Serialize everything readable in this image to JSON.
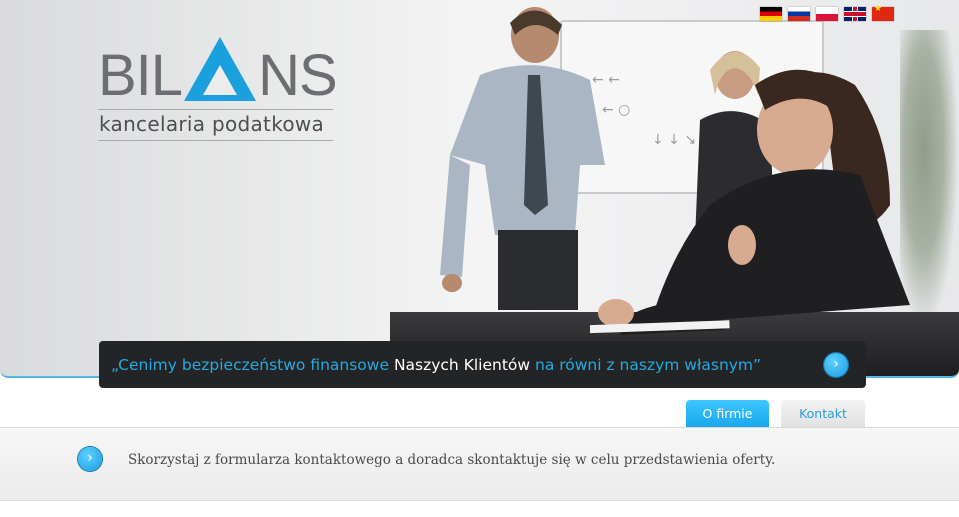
{
  "header": {
    "languages": [
      {
        "code": "de",
        "icon": "germany-flag-icon"
      },
      {
        "code": "ru",
        "icon": "russia-flag-icon"
      },
      {
        "code": "pl",
        "icon": "poland-flag-icon"
      },
      {
        "code": "en",
        "icon": "uk-flag-icon"
      },
      {
        "code": "zh",
        "icon": "china-flag-icon"
      }
    ],
    "logo": {
      "part1": "BIL",
      "part2": "NS",
      "subtitle": "kancelaria podatkowa"
    }
  },
  "quote": {
    "part1": "„Cenimy bezpieczeństwo finansowe ",
    "highlight": "Naszych Klientów",
    "part2": " na równi z naszym własnym”",
    "button_icon": "chevron-right-icon"
  },
  "tabs": [
    {
      "label": "O firmie",
      "active": true
    },
    {
      "label": "Kontakt",
      "active": false
    }
  ],
  "info": {
    "text": "Skorzystaj z formularza kontaktowego a doradca skontaktuje się w celu przedstawienia oferty.",
    "button_icon": "chevron-right-icon"
  },
  "colors": {
    "accent": "#1aa0dc",
    "quote_bar": "#232426",
    "logo_gray": "#6d6e71"
  }
}
